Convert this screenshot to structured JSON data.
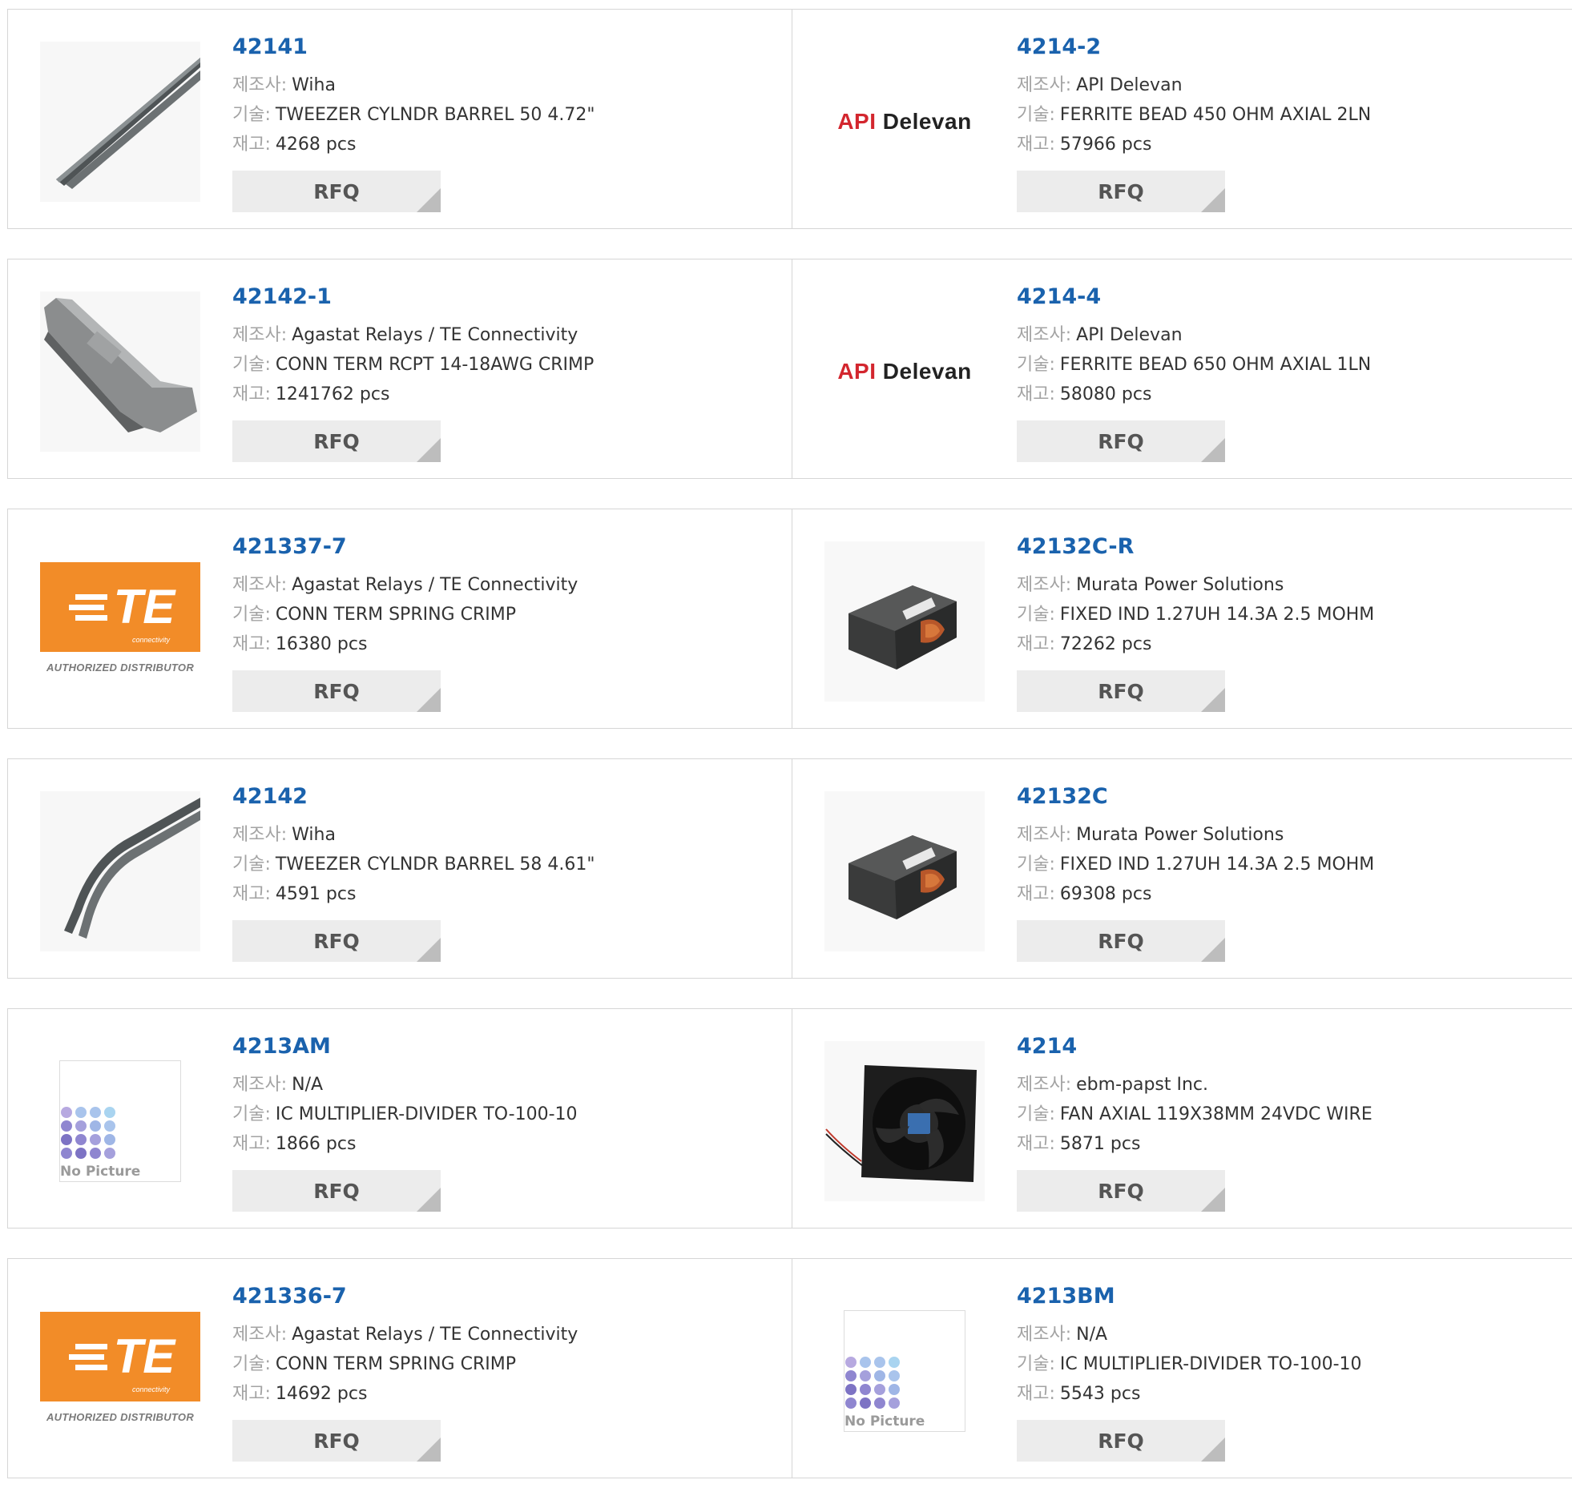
{
  "labels": {
    "manufacturer": "제조사:",
    "description": "기술:",
    "stock": "재고:",
    "rfq": "RFQ"
  },
  "colors": {
    "part_link": "#1a62ad",
    "label_grey": "#a3a3a3",
    "rfq_bg": "#ececec",
    "te_orange": "#f28c28",
    "api_red": "#d3262e"
  },
  "rows": [
    {
      "left": {
        "part": "42141",
        "manufacturer": "Wiha",
        "description": "TWEEZER CYLNDR BARREL 50 4.72\"",
        "stock": "4268 pcs",
        "image": "tweezer-straight"
      },
      "right": {
        "part": "4214-2",
        "manufacturer": "API Delevan",
        "description": "FERRITE BEAD 450 OHM AXIAL 2LN",
        "stock": "57966 pcs",
        "image": "api-delevan-logo"
      }
    },
    {
      "left": {
        "part": "42142-1",
        "manufacturer": "Agastat Relays / TE Connectivity",
        "description": "CONN TERM RCPT 14-18AWG CRIMP",
        "stock": "1241762 pcs",
        "image": "crimp-terminal"
      },
      "right": {
        "part": "4214-4",
        "manufacturer": "API Delevan",
        "description": "FERRITE BEAD 650 OHM AXIAL 1LN",
        "stock": "58080 pcs",
        "image": "api-delevan-logo"
      }
    },
    {
      "left": {
        "part": "421337-7",
        "manufacturer": "Agastat Relays / TE Connectivity",
        "description": "CONN TERM SPRING CRIMP",
        "stock": "16380 pcs",
        "image": "te-logo"
      },
      "right": {
        "part": "42132C-R",
        "manufacturer": "Murata Power Solutions",
        "description": "FIXED IND 1.27UH 14.3A 2.5 MOHM",
        "stock": "72262 pcs",
        "image": "inductor"
      }
    },
    {
      "left": {
        "part": "42142",
        "manufacturer": "Wiha",
        "description": "TWEEZER CYLNDR BARREL 58 4.61\"",
        "stock": "4591 pcs",
        "image": "tweezer-bent"
      },
      "right": {
        "part": "42132C",
        "manufacturer": "Murata Power Solutions",
        "description": "FIXED IND 1.27UH 14.3A 2.5 MOHM",
        "stock": "69308 pcs",
        "image": "inductor"
      }
    },
    {
      "left": {
        "part": "4213AM",
        "manufacturer": "N/A",
        "description": "IC MULTIPLIER-DIVIDER TO-100-10",
        "stock": "1866 pcs",
        "image": "no-picture"
      },
      "right": {
        "part": "4214",
        "manufacturer": "ebm-papst Inc.",
        "description": "FAN AXIAL 119X38MM 24VDC WIRE",
        "stock": "5871 pcs",
        "image": "fan"
      }
    },
    {
      "left": {
        "part": "421336-7",
        "manufacturer": "Agastat Relays / TE Connectivity",
        "description": "CONN TERM SPRING CRIMP",
        "stock": "14692 pcs",
        "image": "te-logo"
      },
      "right": {
        "part": "4213BM",
        "manufacturer": "N/A",
        "description": "IC MULTIPLIER-DIVIDER TO-100-10",
        "stock": "5543 pcs",
        "image": "no-picture"
      }
    }
  ],
  "logos": {
    "api_part1": "API",
    "api_part2": "Delevan",
    "te_text": "TE",
    "te_sub": "connectivity",
    "te_authorized": "AUTHORIZED DISTRIBUTOR",
    "no_picture": "No Picture"
  }
}
